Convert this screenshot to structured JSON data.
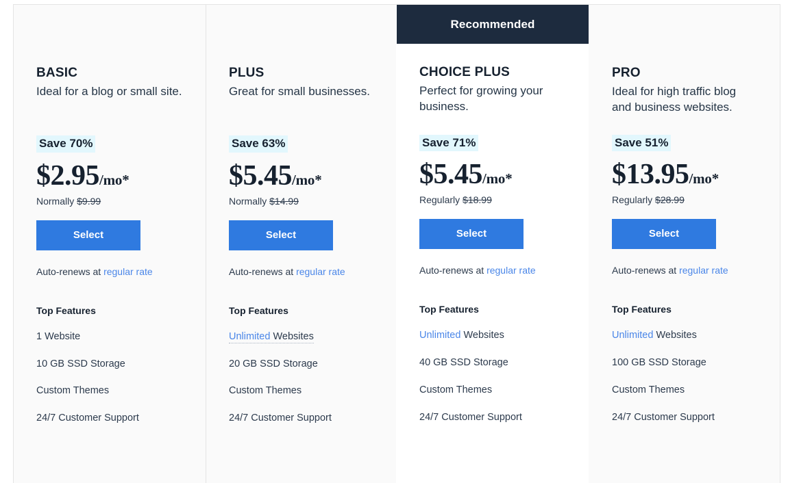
{
  "theme": {
    "accent_button": "#2f7ae0",
    "ribbon_bg": "#1d2b3e",
    "badge_bg": "#e2f7fd",
    "link": "#4a86e8",
    "card_bg": "#fafafa",
    "featured_card_bg": "#ffffff",
    "border": "#e4e4e4"
  },
  "ribbon": {
    "label": "Recommended"
  },
  "labels": {
    "select": "Select",
    "renews_prefix": "Auto-renews at",
    "renews_link": "regular rate",
    "features_title": "Top Features"
  },
  "plans": [
    {
      "name": "BASIC",
      "tagline": "Ideal for a blog or small site.",
      "save_badge": "Save 70%",
      "price_amount": "$2.95",
      "price_period": "/mo*",
      "was_prefix": "Normally",
      "was_price": "$9.99",
      "select_label": "Select",
      "renews_prefix": "Auto-renews at",
      "renews_link": "regular rate",
      "features_title": "Top Features",
      "features": [
        {
          "highlight": "",
          "text": "1 Website",
          "dotted": false
        },
        {
          "highlight": "",
          "text": "10 GB SSD Storage",
          "dotted": false
        },
        {
          "highlight": "",
          "text": "Custom Themes",
          "dotted": false
        },
        {
          "highlight": "",
          "text": "24/7 Customer Support",
          "dotted": false
        }
      ],
      "recommended": false
    },
    {
      "name": "PLUS",
      "tagline": "Great for small businesses.",
      "save_badge": "Save 63%",
      "price_amount": "$5.45",
      "price_period": "/mo*",
      "was_prefix": "Normally",
      "was_price": "$14.99",
      "select_label": "Select",
      "renews_prefix": "Auto-renews at",
      "renews_link": "regular rate",
      "features_title": "Top Features",
      "features": [
        {
          "highlight": "Unlimited",
          "text": "Websites",
          "dotted": true
        },
        {
          "highlight": "",
          "text": "20 GB SSD Storage",
          "dotted": false
        },
        {
          "highlight": "",
          "text": "Custom Themes",
          "dotted": false
        },
        {
          "highlight": "",
          "text": "24/7 Customer Support",
          "dotted": false
        }
      ],
      "recommended": false
    },
    {
      "name": "CHOICE PLUS",
      "tagline": "Perfect for growing your business.",
      "save_badge": "Save 71%",
      "price_amount": "$5.45",
      "price_period": "/mo*",
      "was_prefix": "Regularly",
      "was_price": "$18.99",
      "select_label": "Select",
      "renews_prefix": "Auto-renews at",
      "renews_link": "regular rate",
      "features_title": "Top Features",
      "features": [
        {
          "highlight": "Unlimited",
          "text": "Websites",
          "dotted": false
        },
        {
          "highlight": "",
          "text": "40 GB SSD Storage",
          "dotted": false
        },
        {
          "highlight": "",
          "text": "Custom Themes",
          "dotted": false
        },
        {
          "highlight": "",
          "text": "24/7 Customer Support",
          "dotted": false
        }
      ],
      "recommended": true
    },
    {
      "name": "PRO",
      "tagline": "Ideal for high traffic blog and business websites.",
      "save_badge": "Save 51%",
      "price_amount": "$13.95",
      "price_period": "/mo*",
      "was_prefix": "Regularly",
      "was_price": "$28.99",
      "select_label": "Select",
      "renews_prefix": "Auto-renews at",
      "renews_link": "regular rate",
      "features_title": "Top Features",
      "features": [
        {
          "highlight": "Unlimited",
          "text": "Websites",
          "dotted": false
        },
        {
          "highlight": "",
          "text": "100 GB SSD Storage",
          "dotted": false
        },
        {
          "highlight": "",
          "text": "Custom Themes",
          "dotted": false
        },
        {
          "highlight": "",
          "text": "24/7 Customer Support",
          "dotted": false
        }
      ],
      "recommended": false
    }
  ]
}
